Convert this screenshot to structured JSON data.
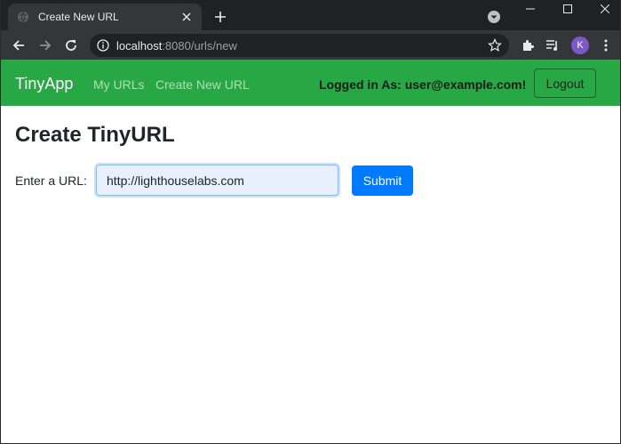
{
  "browser": {
    "tab_title": "Create New URL",
    "url_host": "localhost",
    "url_rest": ":8080/urls/new",
    "profile_initial": "K"
  },
  "navbar": {
    "brand": "TinyApp",
    "links": [
      "My URLs",
      "Create New URL"
    ],
    "logged_in_text": "Logged in As: user@example.com!",
    "logout_label": "Logout",
    "color": "#28a745"
  },
  "main": {
    "title": "Create TinyURL",
    "url_label": "Enter a URL:",
    "url_value": "http://lighthouselabs.com",
    "submit_label": "Submit"
  },
  "icons": [
    "globe-icon",
    "close-icon",
    "plus-icon",
    "dropdown-icon",
    "minimize-icon",
    "maximize-icon",
    "close-window-icon",
    "back-icon",
    "forward-icon",
    "reload-icon",
    "info-icon",
    "star-icon",
    "extensions-icon",
    "media-icon",
    "menu-icon"
  ]
}
